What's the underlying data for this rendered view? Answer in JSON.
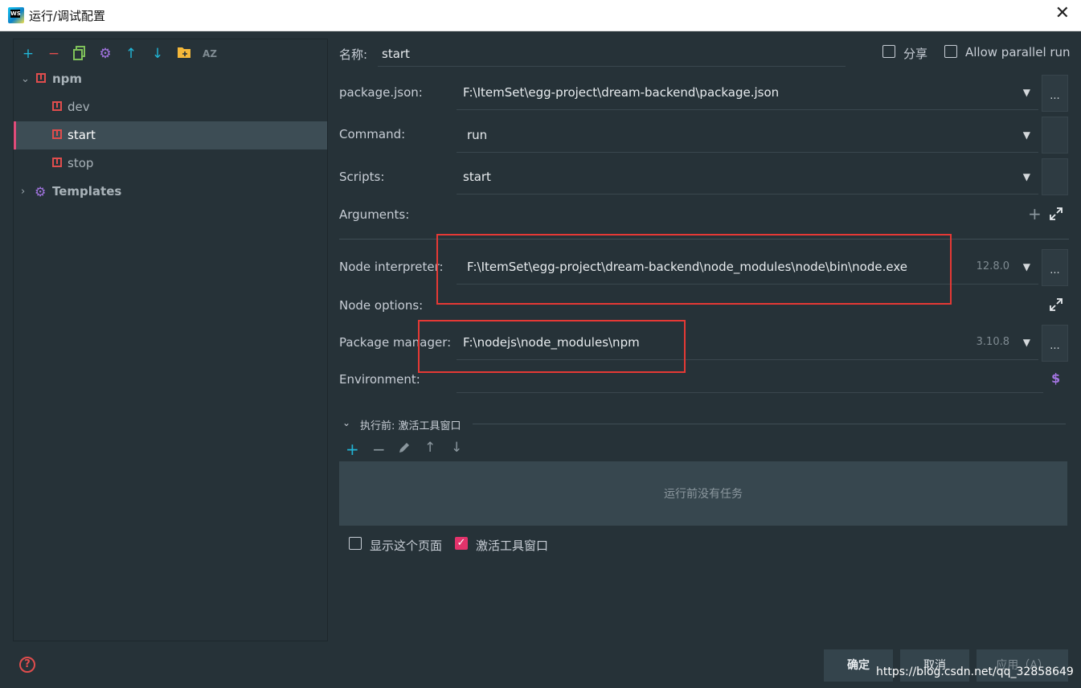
{
  "window": {
    "title": "运行/调试配置",
    "app_badge": "WS"
  },
  "toolbar": {
    "icons": [
      "add-icon",
      "remove-icon",
      "copy-icon",
      "settings-icon",
      "move-up-icon",
      "move-down-icon",
      "folder-icon",
      "sort-az-icon"
    ]
  },
  "tree": {
    "npm_label": "npm",
    "items": [
      {
        "label": "dev"
      },
      {
        "label": "start"
      },
      {
        "label": "stop"
      }
    ],
    "templates_label": "Templates"
  },
  "form": {
    "name_label": "名称:",
    "name_value": "start",
    "share_label": "分享",
    "parallel_label": "Allow parallel run",
    "package_json_label": "package.json:",
    "package_json_value": "F:\\ItemSet\\egg-project\\dream-backend\\package.json",
    "command_label": "Command:",
    "command_value": "run",
    "scripts_label": "Scripts:",
    "scripts_value": "start",
    "arguments_label": "Arguments:",
    "node_interpreter_label": "Node interpreter:",
    "node_interpreter_value": "F:\\ItemSet\\egg-project\\dream-backend\\node_modules\\node\\bin\\node.exe",
    "node_version": "12.8.0",
    "node_options_label": "Node options:",
    "package_manager_label": "Package manager:",
    "package_manager_value": "F:\\nodejs\\node_modules\\npm",
    "package_manager_version": "3.10.8",
    "environment_label": "Environment:",
    "dots_label": "..."
  },
  "before_launch": {
    "header": "执行前: 激活工具窗口",
    "empty_text": "运行前没有任务",
    "show_page_label": "显示这个页面",
    "show_page_checked": false,
    "activate_tool_window_label": "激活工具窗口",
    "activate_tool_window_checked": true
  },
  "buttons": {
    "ok": "确定",
    "cancel": "取消",
    "apply": "应用（A）"
  },
  "watermark": "https://blog.csdn.net/qq_32858649",
  "colors": {
    "background": "#263238",
    "accent_pink": "#e2336b",
    "highlight_red": "#e53935",
    "npm_red": "#e04d4d",
    "add_cyan": "#21b5d6",
    "gear_purple": "#a274e0"
  }
}
